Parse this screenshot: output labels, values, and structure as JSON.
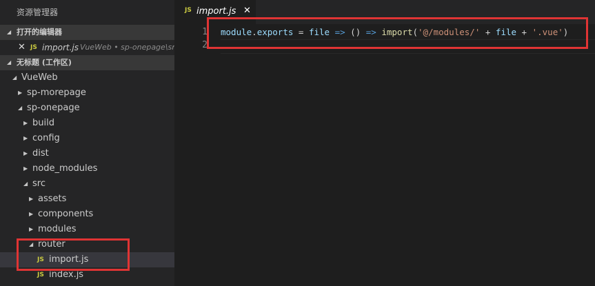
{
  "sidebar": {
    "title": "资源管理器",
    "open_editors_header": "打开的编辑器",
    "open_editor": {
      "icon": "JS",
      "name": "import.js",
      "desc": "VueWeb • sp-onepage\\sr..."
    },
    "workspace_header": "无标题 (工作区)",
    "tree": [
      {
        "label": "VueWeb",
        "expanded": true
      },
      {
        "label": "sp-morepage",
        "expanded": false
      },
      {
        "label": "sp-onepage",
        "expanded": true
      },
      {
        "label": "build",
        "expanded": false
      },
      {
        "label": "config",
        "expanded": false
      },
      {
        "label": "dist",
        "expanded": false
      },
      {
        "label": "node_modules",
        "expanded": false
      },
      {
        "label": "src",
        "expanded": true
      },
      {
        "label": "assets",
        "expanded": false
      },
      {
        "label": "components",
        "expanded": false
      },
      {
        "label": "modules",
        "expanded": false
      },
      {
        "label": "router",
        "expanded": true
      },
      {
        "icon": "JS",
        "label": "import.js"
      },
      {
        "icon": "JS",
        "label": "index.js"
      }
    ]
  },
  "editor": {
    "tab": {
      "icon": "JS",
      "name": "import.js",
      "close": "✕"
    },
    "line_numbers": [
      "1",
      "2"
    ],
    "code_tokens": [
      {
        "t": "module",
        "c": "var"
      },
      {
        "t": ".",
        "c": "op"
      },
      {
        "t": "exports",
        "c": "var"
      },
      {
        "t": " = ",
        "c": "op"
      },
      {
        "t": "file",
        "c": "var"
      },
      {
        "t": " => ",
        "c": "kw"
      },
      {
        "t": "() ",
        "c": "op"
      },
      {
        "t": "=>",
        "c": "kw"
      },
      {
        "t": " ",
        "c": "op"
      },
      {
        "t": "import",
        "c": "fn"
      },
      {
        "t": "(",
        "c": "op"
      },
      {
        "t": "'@/modules/'",
        "c": "str"
      },
      {
        "t": " + ",
        "c": "op"
      },
      {
        "t": "file",
        "c": "var"
      },
      {
        "t": " + ",
        "c": "op"
      },
      {
        "t": "'.vue'",
        "c": "str"
      },
      {
        "t": ")",
        "c": "op"
      }
    ]
  },
  "colors": {
    "highlight_box": "#e03434",
    "js_icon": "#cbcb41",
    "sidebar_bg": "#252526",
    "editor_bg": "#1e1e1e"
  }
}
